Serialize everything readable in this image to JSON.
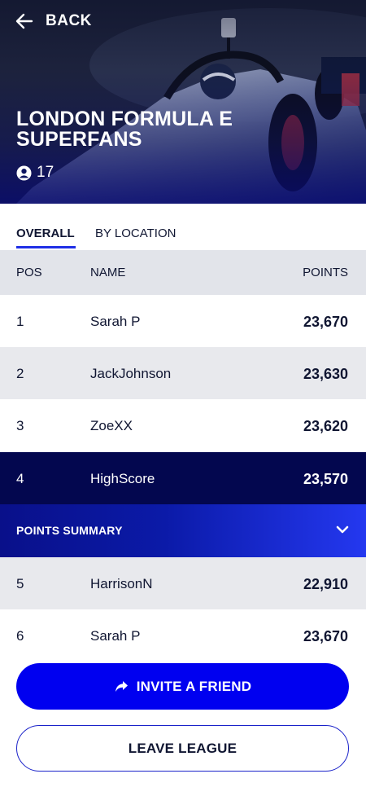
{
  "header": {
    "back_label": "BACK",
    "title": "LONDON FORMULA E SUPERFANS",
    "member_count": "17",
    "icons": {
      "back": "arrow-left-icon",
      "members": "user-circle-icon"
    }
  },
  "tabs": [
    {
      "label": "OVERALL",
      "active": true
    },
    {
      "label": "BY LOCATION",
      "active": false
    }
  ],
  "table": {
    "columns": {
      "pos": "POS",
      "name": "NAME",
      "points": "POINTS"
    },
    "rows": [
      {
        "pos": "1",
        "name": "Sarah P",
        "points": "23,670"
      },
      {
        "pos": "2",
        "name": "JackJohnson",
        "points": "23,630"
      },
      {
        "pos": "3",
        "name": "ZoeXX",
        "points": "23,620"
      },
      {
        "pos": "4",
        "name": "HighScore",
        "points": "23,570",
        "current_user": true
      },
      {
        "pos": "5",
        "name": "HarrisonN",
        "points": "22,910"
      },
      {
        "pos": "6",
        "name": "Sarah P",
        "points": "23,670"
      }
    ],
    "summary_label": "POINTS SUMMARY"
  },
  "actions": {
    "invite_label": "INVITE A FRIEND",
    "leave_label": "LEAVE LEAGUE"
  },
  "colors": {
    "primary": "#0000f0",
    "highlight_row": "#03074f",
    "header_bg": "#e2e4ea",
    "text": "#101632"
  }
}
